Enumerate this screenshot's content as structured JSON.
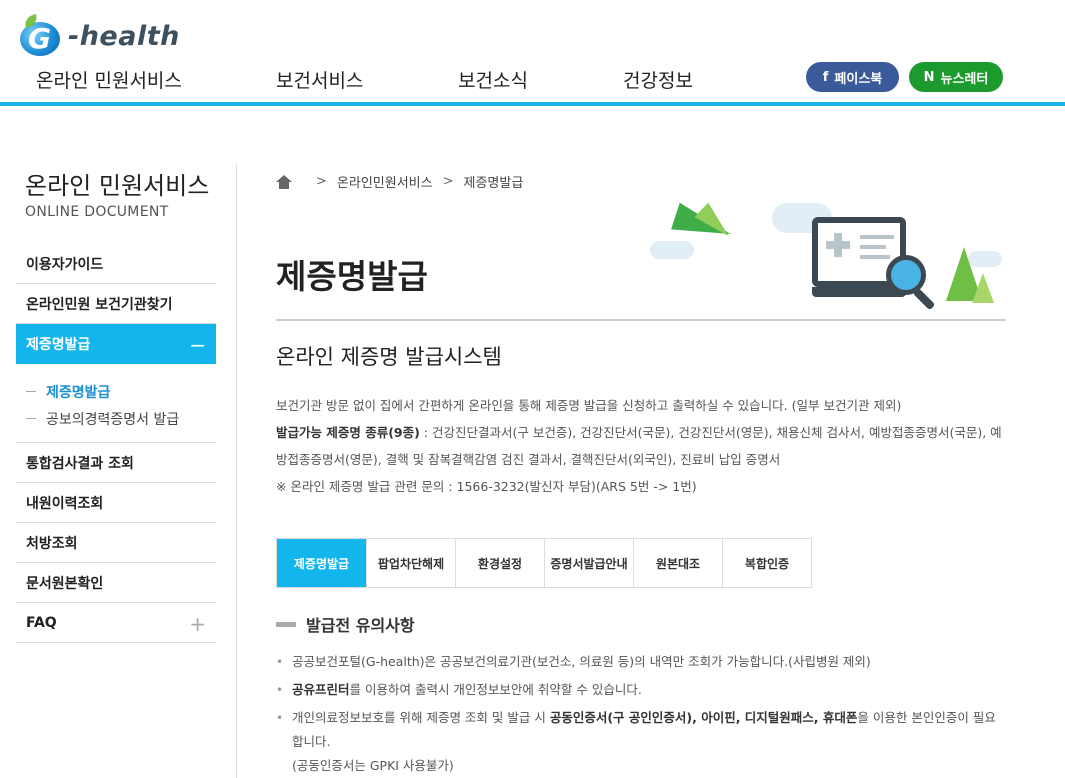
{
  "header": {
    "logo_text": "-health",
    "logo_letter": "G",
    "nav": [
      {
        "label": "온라인 민원서비스"
      },
      {
        "label": "보건서비스"
      },
      {
        "label": "보건소식"
      },
      {
        "label": "건강정보"
      }
    ],
    "facebook": {
      "icon": "f",
      "label": "페이스북",
      "color": "#3b5a9a"
    },
    "newsletter": {
      "icon": "N",
      "label": "뉴스레터",
      "color": "#1d9a2e"
    }
  },
  "sidebar": {
    "title": "온라인 민원서비스",
    "subtitle": "ONLINE DOCUMENT",
    "items": [
      {
        "label": "이용자가이드"
      },
      {
        "label": "온라인민원 보건기관찾기"
      },
      {
        "label": "제증명발급",
        "sign": "−"
      },
      {
        "label": "통합검사결과 조회"
      },
      {
        "label": "내원이력조회"
      },
      {
        "label": "처방조회"
      },
      {
        "label": "문서원본확인"
      },
      {
        "label": "FAQ",
        "sign": "+"
      }
    ],
    "subitems": [
      {
        "label": "제증명발급"
      },
      {
        "label": "공보의경력증명서 발급"
      }
    ]
  },
  "breadcrumb": {
    "items": [
      "온라인민원서비스",
      "제증명발급"
    ]
  },
  "page": {
    "title": "제증명발급",
    "section_title": "온라인 제증명 발급시스템",
    "desc_line1": "보건기관 방문 없이 집에서 간편하게 온라인을 통해 제증명 발급을 신청하고 출력하실 수 있습니다. (일부 보건기관 제외)",
    "desc_bold": "발급가능 제증명 종류(9종)",
    "desc_line2": " : 건강진단결과서(구 보건증), 건강진단서(국문), 건강진단서(영문), 채용신체 검사서, 예방접종증명서(국문), 예방접종증명서(영문), 결핵 및 잠복결핵감염 검진 결과서, 결핵진단서(외국인), 진료비 납입 증명서",
    "desc_line3": "※ 온라인 제증명 발급 관련 문의 : 1566-3232(발신자 부담)(ARS 5번 -> 1번)"
  },
  "tabs": [
    {
      "label": "제증명발급"
    },
    {
      "label": "팝업차단해제"
    },
    {
      "label": "환경설정"
    },
    {
      "label": "증명서발급안내"
    },
    {
      "label": "원본대조"
    },
    {
      "label": "복합인증"
    }
  ],
  "notice": {
    "title": "발급전 유의사항",
    "n1": "공공보건포털(G-health)은 공공보건의료기관(보건소, 의료원 등)의 내역만 조회가 가능합니다.(사립병원 제외)",
    "n2_bold": "공유프린터",
    "n2_rest": "를 이용하여 출력시 개인정보보안에 취약할 수 있습니다.",
    "n3_a": "개인의료정보보호를 위해 제증명 조회 및 발급 시 ",
    "n3_b1": "공동인증서(구 공인인증서), 아이핀, 디지털원패스, 휴대폰",
    "n3_c": "을 이용한 본인인증이 필요합니다.",
    "n3_d": "(공동인증서는 GPKI 사용불가)"
  },
  "colors": {
    "accent": "#12b5ec",
    "rule": "#1ab3e6"
  }
}
